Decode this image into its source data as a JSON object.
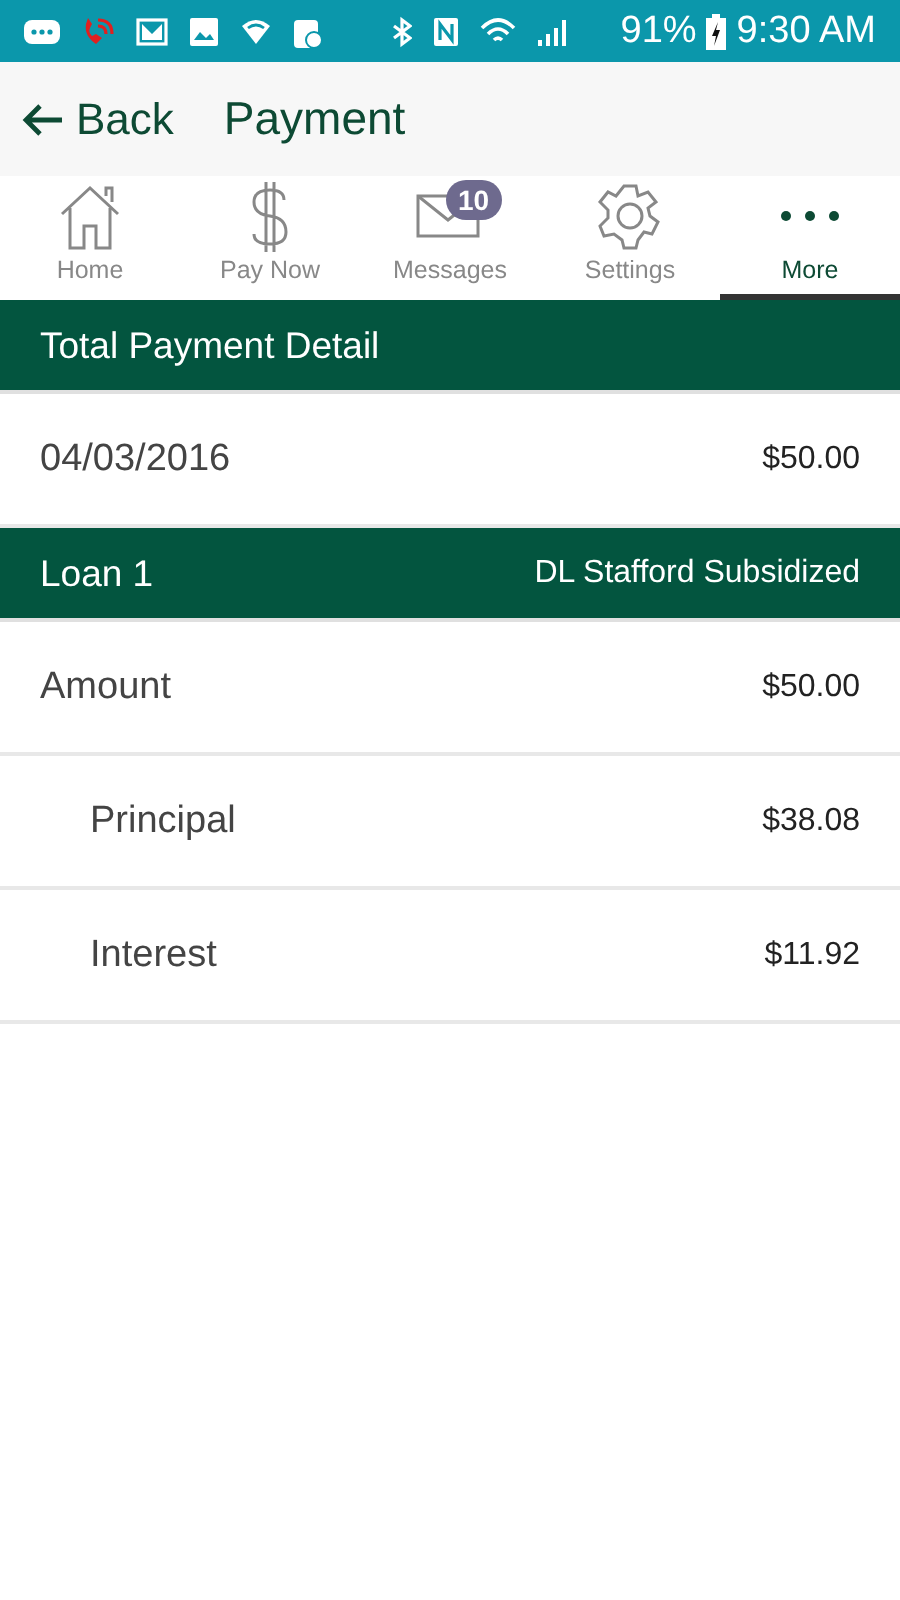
{
  "status_bar": {
    "battery": "91%",
    "time": "9:30 AM"
  },
  "app_bar": {
    "back": "Back",
    "title": "Payment"
  },
  "tabs": [
    {
      "label": "Home",
      "selected": false
    },
    {
      "label": "Pay Now",
      "selected": false
    },
    {
      "label": "Messages",
      "selected": false,
      "badge": "10"
    },
    {
      "label": "Settings",
      "selected": false
    },
    {
      "label": "More",
      "selected": true
    }
  ],
  "sections": [
    {
      "title": "Total Payment Detail",
      "rows": [
        {
          "label": "04/03/2016",
          "value": "$50.00",
          "kind": "main"
        }
      ]
    },
    {
      "title": "Loan 1",
      "subtitle": "DL Stafford Subsidized",
      "rows": [
        {
          "label": "Amount",
          "value": "$50.00",
          "kind": "main"
        },
        {
          "label": "Principal",
          "value": "$38.08",
          "kind": "sub"
        },
        {
          "label": "Interest",
          "value": "$11.92",
          "kind": "sub"
        }
      ]
    }
  ]
}
